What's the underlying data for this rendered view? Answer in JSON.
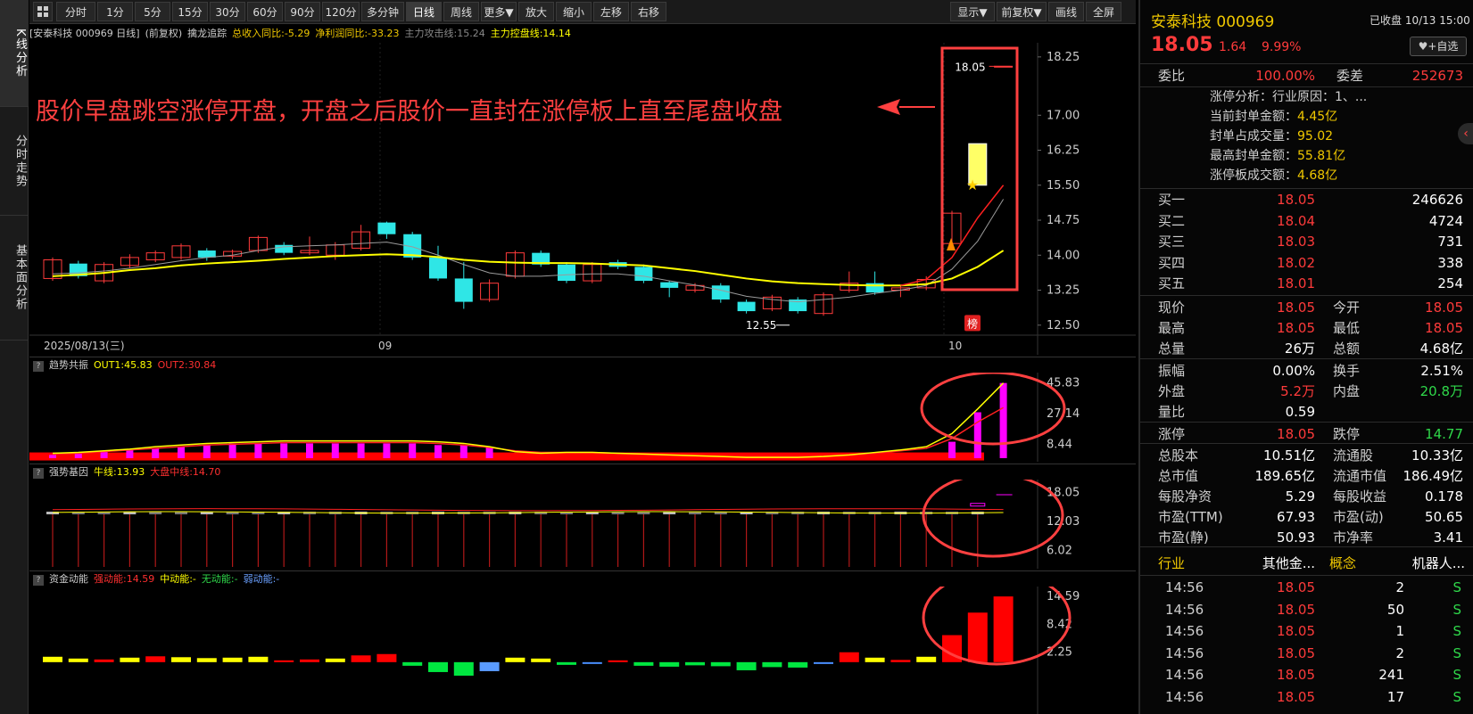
{
  "toolbar": {
    "buttons": [
      "分时",
      "1分",
      "5分",
      "15分",
      "30分",
      "60分",
      "90分",
      "120分",
      "多分钟",
      "日线",
      "周线",
      "更多▼",
      "放大",
      "缩小",
      "左移",
      "右移"
    ],
    "right_buttons": [
      "显示▼",
      "前复权▼",
      "画线",
      "全屏"
    ],
    "active": "日线"
  },
  "left_tabs": [
    "K线分析",
    "分时走势",
    "基本面分析"
  ],
  "info": {
    "symbol": "[安泰科技 000969 日线]",
    "adjust": "(前复权)",
    "indicator": "擒龙追踪",
    "revenue": "总收入同比:-5.29",
    "profit": "净利润同比:-33.23",
    "attack": "主力攻击线:15.24",
    "control": "主力控盘线:14.14"
  },
  "annotation": "股价早盘跳空涨停开盘，开盘之后股价一直封在涨停板上直至尾盘收盘",
  "chart_data": [
    {
      "type": "candlestick",
      "y_axis": [
        "18.25",
        "17.00",
        "16.25",
        "15.50",
        "14.75",
        "14.00",
        "13.25",
        "12.50"
      ],
      "ylim": [
        12.4,
        18.4
      ],
      "x_labels": [
        "2025/08/13(三)",
        "09",
        "10"
      ],
      "candles": [
        {
          "o": 13.5,
          "c": 13.9,
          "h": 13.95,
          "l": 13.45
        },
        {
          "o": 13.82,
          "c": 13.55,
          "h": 13.88,
          "l": 13.5
        },
        {
          "o": 13.45,
          "c": 13.8,
          "h": 13.85,
          "l": 13.4
        },
        {
          "o": 13.78,
          "c": 13.95,
          "h": 14.02,
          "l": 13.72
        },
        {
          "o": 13.9,
          "c": 14.05,
          "h": 14.1,
          "l": 13.85
        },
        {
          "o": 13.95,
          "c": 14.2,
          "h": 14.25,
          "l": 13.9
        },
        {
          "o": 14.1,
          "c": 13.95,
          "h": 14.15,
          "l": 13.88
        },
        {
          "o": 13.98,
          "c": 14.08,
          "h": 14.12,
          "l": 13.92
        },
        {
          "o": 14.1,
          "c": 14.38,
          "h": 14.42,
          "l": 14.05
        },
        {
          "o": 14.22,
          "c": 14.05,
          "h": 14.28,
          "l": 14.0
        },
        {
          "o": 14.05,
          "c": 14.1,
          "h": 14.4,
          "l": 14.0
        },
        {
          "o": 14.0,
          "c": 14.22,
          "h": 14.28,
          "l": 13.9
        },
        {
          "o": 14.15,
          "c": 14.5,
          "h": 14.65,
          "l": 14.1
        },
        {
          "o": 14.7,
          "c": 14.45,
          "h": 14.72,
          "l": 14.35
        },
        {
          "o": 14.45,
          "c": 13.95,
          "h": 14.5,
          "l": 13.9
        },
        {
          "o": 13.95,
          "c": 13.5,
          "h": 14.2,
          "l": 13.45
        },
        {
          "o": 13.5,
          "c": 13.0,
          "h": 13.85,
          "l": 12.85
        },
        {
          "o": 13.05,
          "c": 13.4,
          "h": 13.48,
          "l": 13.0
        },
        {
          "o": 13.55,
          "c": 14.05,
          "h": 14.1,
          "l": 13.5
        },
        {
          "o": 14.05,
          "c": 13.8,
          "h": 14.1,
          "l": 13.75
        },
        {
          "o": 13.8,
          "c": 13.45,
          "h": 13.85,
          "l": 13.4
        },
        {
          "o": 13.45,
          "c": 13.8,
          "h": 13.85,
          "l": 13.4
        },
        {
          "o": 13.85,
          "c": 13.75,
          "h": 13.9,
          "l": 13.7
        },
        {
          "o": 13.75,
          "c": 13.45,
          "h": 13.8,
          "l": 13.4
        },
        {
          "o": 13.42,
          "c": 13.3,
          "h": 13.45,
          "l": 13.1
        },
        {
          "o": 13.25,
          "c": 13.35,
          "h": 13.4,
          "l": 13.2
        },
        {
          "o": 13.35,
          "c": 13.05,
          "h": 13.4,
          "l": 12.98
        },
        {
          "o": 13.0,
          "c": 12.8,
          "h": 13.05,
          "l": 12.75
        },
        {
          "o": 12.85,
          "c": 13.1,
          "h": 13.15,
          "l": 12.8
        },
        {
          "o": 13.05,
          "c": 12.8,
          "h": 13.1,
          "l": 12.75
        },
        {
          "o": 12.75,
          "c": 13.15,
          "h": 13.2,
          "l": 12.7
        },
        {
          "o": 13.25,
          "c": 13.4,
          "h": 13.65,
          "l": 13.2
        },
        {
          "o": 13.4,
          "c": 13.2,
          "h": 13.65,
          "l": 13.15
        },
        {
          "o": 13.25,
          "c": 13.3,
          "h": 13.35,
          "l": 13.1
        },
        {
          "o": 13.3,
          "c": 13.48,
          "h": 13.55,
          "l": 13.25
        },
        {
          "o": 14.25,
          "c": 14.9,
          "h": 14.95,
          "l": 14.2
        },
        {
          "o": 15.5,
          "c": 16.39,
          "h": 16.39,
          "l": 15.5
        },
        {
          "o": 18.05,
          "c": 18.05,
          "h": 18.05,
          "l": 18.05
        }
      ],
      "ma_yellow": [
        13.55,
        13.58,
        13.62,
        13.68,
        13.72,
        13.78,
        13.82,
        13.85,
        13.88,
        13.92,
        13.95,
        13.98,
        14.0,
        14.02,
        14.0,
        13.96,
        13.9,
        13.86,
        13.84,
        13.83,
        13.83,
        13.82,
        13.8,
        13.78,
        13.72,
        13.66,
        13.58,
        13.5,
        13.44,
        13.4,
        13.38,
        13.36,
        13.35,
        13.35,
        13.38,
        13.5,
        13.75,
        14.1
      ],
      "ma_white": [
        13.6,
        13.62,
        13.66,
        13.72,
        13.8,
        13.88,
        13.95,
        14.0,
        14.1,
        14.18,
        14.2,
        14.22,
        14.25,
        14.28,
        14.18,
        14.0,
        13.8,
        13.62,
        13.55,
        13.55,
        13.58,
        13.6,
        13.6,
        13.55,
        13.45,
        13.36,
        13.25,
        13.12,
        13.05,
        13.0,
        13.05,
        13.1,
        13.18,
        13.25,
        13.35,
        13.7,
        14.3,
        15.2
      ],
      "annotations": {
        "high_label": "18.05",
        "low_label": "12.55",
        "star": "★",
        "badge": "榜"
      }
    },
    {
      "type": "bar+line",
      "name": "趋势共振",
      "y_axis": [
        "45.83",
        "27.14",
        "8.44"
      ],
      "ylim": [
        0,
        50
      ],
      "bars": [
        2,
        3,
        4,
        5,
        6,
        7,
        8,
        9,
        9,
        9,
        9,
        9,
        9,
        9,
        9,
        8,
        8,
        7,
        0,
        0,
        0,
        0,
        0,
        0,
        0,
        0,
        0,
        0,
        0,
        0,
        0,
        0,
        0,
        0,
        0,
        10,
        28,
        45.83
      ],
      "out1": [
        3,
        3.5,
        4.5,
        5.5,
        7,
        8,
        9,
        9.5,
        10,
        10.5,
        10.5,
        10.5,
        10.5,
        10.5,
        10.5,
        10,
        9,
        7,
        4,
        3,
        3.5,
        3.5,
        3,
        2.5,
        2,
        1.5,
        1,
        0.5,
        0.5,
        0.5,
        1,
        2,
        3.5,
        5,
        7,
        15,
        30,
        45.83
      ],
      "out2": [
        2.5,
        3,
        4,
        5,
        6,
        7,
        8,
        8.5,
        9,
        9.5,
        9.5,
        9.5,
        9.5,
        9.5,
        9.5,
        9,
        8,
        6.5,
        4.5,
        3.5,
        3.5,
        3.5,
        3,
        2.5,
        2,
        1.5,
        1,
        0.8,
        0.8,
        0.8,
        1.2,
        2,
        3,
        4.5,
        6,
        12,
        22,
        30.84
      ],
      "labels": {
        "out1": "OUT1:45.83",
        "out2": "OUT2:30.84"
      }
    },
    {
      "type": "bar+line",
      "name": "强势基因",
      "y_axis": [
        "18.05",
        "12.03",
        "6.02"
      ],
      "ylim": [
        3,
        20
      ],
      "labels": {
        "bull": "牛线:13.93",
        "mid": "大盘中线:14.70"
      }
    },
    {
      "type": "bar",
      "name": "资金动能",
      "y_axis": [
        "14.59",
        "8.42",
        "2.25"
      ],
      "ylim": [
        -3,
        16
      ],
      "values": [
        1.2,
        0.8,
        0.6,
        1.0,
        1.3,
        1.1,
        0.9,
        1.0,
        1.2,
        0.4,
        0.6,
        0.8,
        1.5,
        1.8,
        -0.8,
        -2.2,
        -3.0,
        -2.0,
        1.0,
        0.8,
        -0.6,
        -0.3,
        0.4,
        -0.8,
        -1.0,
        -0.7,
        -0.9,
        -1.8,
        -1.1,
        -1.2,
        -0.4,
        2.2,
        1.0,
        0.5,
        1.2,
        6.0,
        11.0,
        14.59
      ],
      "labels": {
        "strong": "强动能:14.59",
        "mid": "中动能:-",
        "none": "无动能:-",
        "weak": "弱动能:-"
      }
    }
  ],
  "quote": {
    "name_code": "安泰科技 000969",
    "status": "已收盘 10/13 15:00",
    "price": "18.05",
    "change": "1.64",
    "pct": "9.99%",
    "watch_button": "+自选",
    "weibi_label": "委比",
    "weibi": "100.00%",
    "weicha_label": "委差",
    "weicha": "252673",
    "limit_analysis": "涨停分析：行业原因：1、...",
    "seal_amount_label": "当前封单金额：",
    "seal_amount": "4.45亿",
    "seal_ratio_label": "封单占成交量：",
    "seal_ratio": "95.02",
    "max_seal_label": "最高封单金额：",
    "max_seal": "55.81亿",
    "limit_turnover_label": "涨停板成交额：",
    "limit_turnover": "4.68亿",
    "bids": [
      {
        "label": "买一",
        "price": "18.05",
        "vol": "246626"
      },
      {
        "label": "买二",
        "price": "18.04",
        "vol": "4724"
      },
      {
        "label": "买三",
        "price": "18.03",
        "vol": "731"
      },
      {
        "label": "买四",
        "price": "18.02",
        "vol": "338"
      },
      {
        "label": "买五",
        "price": "18.01",
        "vol": "254"
      }
    ],
    "stats1": [
      [
        {
          "l": "现价",
          "v": "18.05",
          "c": "red"
        },
        {
          "l": "今开",
          "v": "18.05",
          "c": "red"
        }
      ],
      [
        {
          "l": "最高",
          "v": "18.05",
          "c": "red"
        },
        {
          "l": "最低",
          "v": "18.05",
          "c": "red"
        }
      ],
      [
        {
          "l": "总量",
          "v": "26万",
          "c": "white"
        },
        {
          "l": "总额",
          "v": "4.68亿",
          "c": "white"
        }
      ]
    ],
    "stats2": [
      [
        {
          "l": "振幅",
          "v": "0.00%",
          "c": "white"
        },
        {
          "l": "换手",
          "v": "2.51%",
          "c": "white"
        }
      ],
      [
        {
          "l": "外盘",
          "v": "5.2万",
          "c": "red"
        },
        {
          "l": "内盘",
          "v": "20.8万",
          "c": "green"
        }
      ],
      [
        {
          "l": "量比",
          "v": "0.59",
          "c": "white"
        }
      ]
    ],
    "stats3": [
      [
        {
          "l": "涨停",
          "v": "18.05",
          "c": "red"
        },
        {
          "l": "跌停",
          "v": "14.77",
          "c": "green"
        }
      ]
    ],
    "stats4": [
      [
        {
          "l": "总股本",
          "v": "10.51亿",
          "c": "white"
        },
        {
          "l": "流通股",
          "v": "10.33亿",
          "c": "white"
        }
      ],
      [
        {
          "l": "总市值",
          "v": "189.65亿",
          "c": "white"
        },
        {
          "l": "流通市值",
          "v": "186.49亿",
          "c": "white"
        }
      ],
      [
        {
          "l": "每股净资",
          "v": "5.29",
          "c": "white"
        },
        {
          "l": "每股收益",
          "v": "0.178",
          "c": "white"
        }
      ],
      [
        {
          "l": "市盈(TTM)",
          "v": "67.93",
          "c": "white"
        },
        {
          "l": "市盈(动)",
          "v": "50.65",
          "c": "white"
        }
      ],
      [
        {
          "l": "市盈(静)",
          "v": "50.93",
          "c": "white"
        },
        {
          "l": "市净率",
          "v": "3.41",
          "c": "white"
        }
      ]
    ],
    "industry_label": "行业",
    "industry": "其他金...",
    "concept_label": "概念",
    "concept": "机器人...",
    "ticks": [
      {
        "t": "14:56",
        "p": "18.05",
        "v": "2",
        "s": "S"
      },
      {
        "t": "14:56",
        "p": "18.05",
        "v": "50",
        "s": "S"
      },
      {
        "t": "14:56",
        "p": "18.05",
        "v": "1",
        "s": "S"
      },
      {
        "t": "14:56",
        "p": "18.05",
        "v": "2",
        "s": "S"
      },
      {
        "t": "14:56",
        "p": "18.05",
        "v": "241",
        "s": "S"
      },
      {
        "t": "14:56",
        "p": "18.05",
        "v": "17",
        "s": "S"
      }
    ]
  },
  "colors": {
    "up": "#ff3b3b",
    "down": "#2fe6e6",
    "ma1": "#ffff00",
    "ma2": "#ff2020",
    "accent": "#ff4444"
  }
}
